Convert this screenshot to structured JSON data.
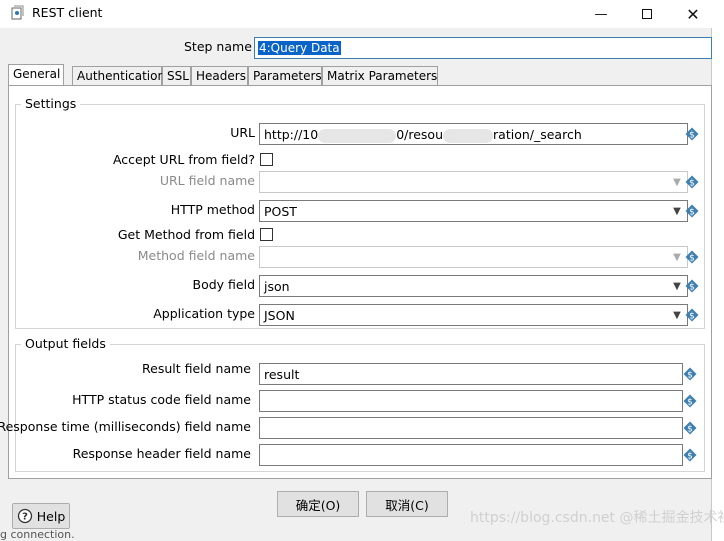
{
  "window": {
    "title": "REST client",
    "close_glyph": "✕",
    "min_glyph": "—"
  },
  "step": {
    "label": "Step name",
    "value": "4:Query Data"
  },
  "tabs": [
    "General",
    "Authentication",
    "SSL",
    "Headers",
    "Parameters",
    "Matrix Parameters"
  ],
  "settings": {
    "title": "Settings",
    "url_label": "URL",
    "url_prefix": "http://10",
    "url_mid": "0/resou",
    "url_suffix": "ration/_search",
    "accept_url_label": "Accept URL from field?",
    "url_field_name_label": "URL field name",
    "http_method_label": "HTTP method",
    "http_method_value": "POST",
    "get_method_label": "Get Method from field",
    "method_field_name_label": "Method field name",
    "body_field_label": "Body field",
    "body_field_value": "json",
    "app_type_label": "Application type",
    "app_type_value": "JSON"
  },
  "output": {
    "title": "Output fields",
    "result_label": "Result field name",
    "result_value": "result",
    "status_label": "HTTP status code field name",
    "response_time_label": "Response time (milliseconds) field name",
    "response_header_label": "Response header field name"
  },
  "buttons": {
    "help": "Help",
    "ok": "确定(O)",
    "cancel": "取消(C)"
  },
  "watermark": "https://blog.csdn.net @稀土掘金技术社区",
  "bottom_text": "g connection."
}
